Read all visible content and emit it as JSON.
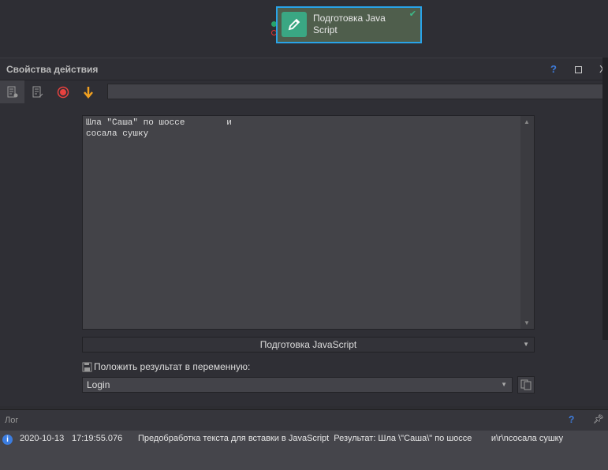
{
  "node": {
    "title": "Подготовка Java Script",
    "icon": "pencil-icon",
    "status": "check-icon"
  },
  "panel": {
    "title": "Свойства действия",
    "help": "?",
    "close": "X"
  },
  "toolbar": {
    "search_value": ""
  },
  "editor": {
    "text": "Шла \"Саша\" по шоссе        и\nсосала сушку"
  },
  "action_select": {
    "value": "Подготовка JavaScript"
  },
  "result_label": "Положить результат в переменную:",
  "variable_select": {
    "value": "Login"
  },
  "log": {
    "title": "Лог",
    "help": "?",
    "entries": [
      {
        "date": "2020-10-13",
        "time": "17:19:55.076",
        "message": "Предобработка текста для вставки в JavaScript  Результат: Шла \\\"Саша\\\" по шоссе        и\\r\\nсосала сушку"
      }
    ]
  },
  "colors": {
    "accent": "#29a3e8",
    "node_icon": "#3aa783",
    "record": "#e8423f",
    "arrow": "#f0a020"
  }
}
